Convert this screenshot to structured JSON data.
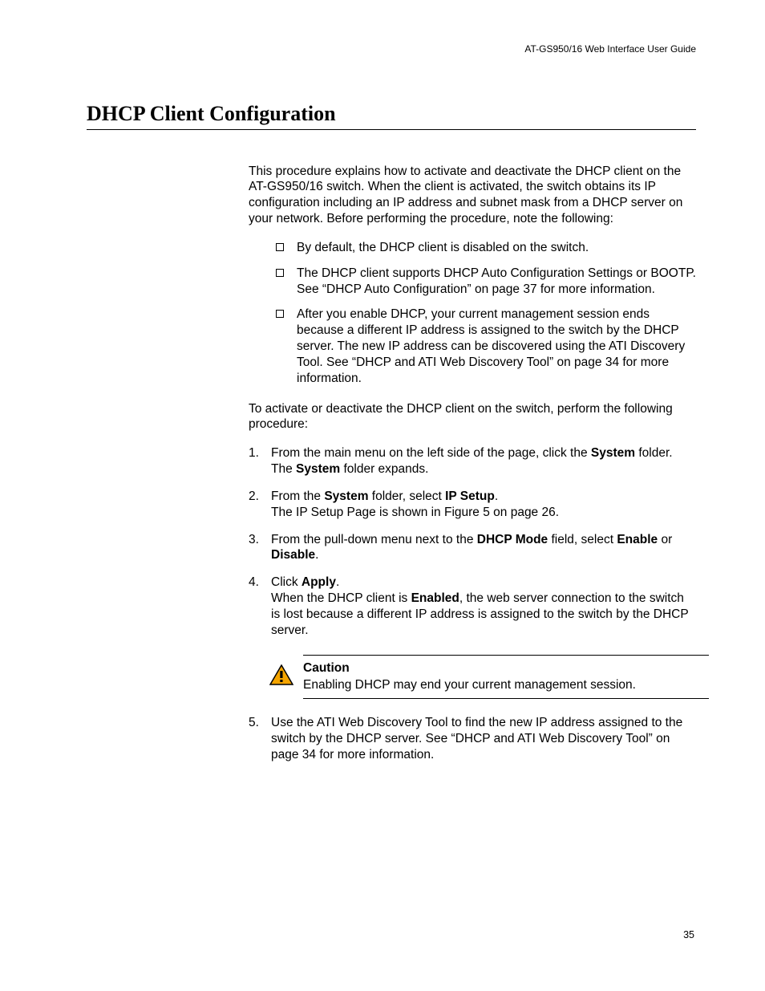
{
  "runningHead": "AT-GS950/16  Web Interface User Guide",
  "title": "DHCP Client Configuration",
  "intro": "This procedure explains how to activate and deactivate the DHCP client on the AT-GS950/16 switch. When the client is activated, the switch obtains its IP configuration including an IP address and subnet mask from a DHCP server on your network. Before performing the procedure, note the following:",
  "bullets": [
    "By default, the DHCP client is disabled on the switch.",
    "The DHCP client supports DHCP Auto Configuration Settings or BOOTP. See “DHCP Auto Configuration” on page 37 for more information.",
    "After you enable DHCP, your current management session ends because a different IP address is assigned to the switch by the DHCP server. The new IP address can be discovered using the ATI Discovery Tool. See “DHCP and ATI Web Discovery Tool” on page 34 for more information."
  ],
  "procIntro": "To activate or deactivate the DHCP client on the switch, perform the following procedure:",
  "steps": {
    "s1": {
      "a": "From the main menu on the left side of the page, click the ",
      "b": "System",
      "c": " folder.",
      "d": "The ",
      "e": "System",
      "f": " folder expands."
    },
    "s2": {
      "a": "From the ",
      "b": "System",
      "c": " folder, select ",
      "d": "IP Setup",
      "e": ".",
      "f": "The IP Setup Page is shown in Figure 5 on page 26."
    },
    "s3": {
      "a": "From the pull-down menu next to the ",
      "b": "DHCP Mode",
      "c": " field, select ",
      "d": "Enable",
      "e": " or ",
      "f": "Disable",
      "g": "."
    },
    "s4": {
      "a": "Click ",
      "b": "Apply",
      "c": ".",
      "d": "When the DHCP client is ",
      "e": "Enabled",
      "f": ", the web server connection to the switch is lost because a different IP address is assigned to the switch by the DHCP server."
    },
    "s5": "Use the ATI Web Discovery Tool to find the new IP address assigned to the switch by the DHCP server. See “DHCP and ATI Web Discovery Tool” on page 34 for more information."
  },
  "caution": {
    "label": "Caution",
    "text": "Enabling DHCP may end your current management session."
  },
  "pageNumber": "35"
}
